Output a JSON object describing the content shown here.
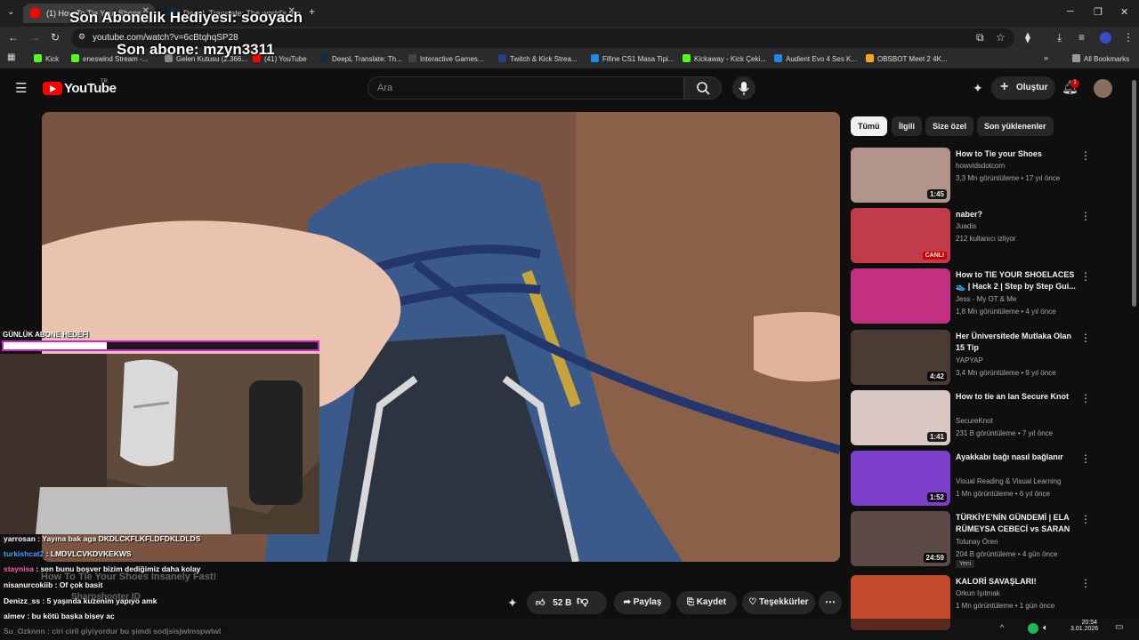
{
  "browser": {
    "tabs": [
      {
        "title": "(1) How To Tie Your Shoes",
        "active": true
      },
      {
        "title": "DeepL Translate: The world's most accurate translator",
        "active": false
      }
    ],
    "new_tab": "+",
    "url": "youtube.com/watch?v=6cBtqhqSP28",
    "bookmarks": [
      {
        "label": "Kick",
        "color": "#53fc18"
      },
      {
        "label": "eneswind Stream -...",
        "color": "#53fc18"
      },
      {
        "label": "Gelen Kutusu (2.366...",
        "color": "#888888"
      },
      {
        "label": "(41) YouTube",
        "color": "#ff0000"
      },
      {
        "label": "DeepL Translate: Th...",
        "color": "#0f2b46"
      },
      {
        "label": "Interactive Games...",
        "color": "#444444"
      },
      {
        "label": "Twitch & Kick Strea...",
        "color": "#2a3f8a"
      },
      {
        "label": "Fifine CS1 Masa Tipi...",
        "color": "#1e88e5"
      },
      {
        "label": "Kickaway - Kick Çeki...",
        "color": "#53fc18"
      },
      {
        "label": "Audient Evo 4 Ses K...",
        "color": "#1e88e5"
      },
      {
        "label": "OBSBOT Meet 2 4K...",
        "color": "#f5a623"
      }
    ],
    "all_bookmarks": "All Bookmarks"
  },
  "youtube": {
    "logo": "YouTube",
    "region": "TR",
    "search_placeholder": "Ara",
    "create_label": "Oluştur",
    "notification_count": "1",
    "chips": [
      "Tümü",
      "İlgili",
      "Size özel",
      "Son yüklenenler"
    ],
    "actions": {
      "likes": "52 B",
      "share": "Paylaş",
      "save": "Kaydet",
      "thanks": "Teşekkürler"
    },
    "recommendations": [
      {
        "title": "How to Tie your Shoes",
        "channel": "howvidsdotcom",
        "meta": "3,3 Mn görüntüleme • 17 yıl önce",
        "duration": "1:45",
        "color": "#b3948d"
      },
      {
        "title": "naber?",
        "channel": "Juadis",
        "meta": "212 kullanıcı izliyor",
        "badge": "CANLI",
        "color": "#c23b4a"
      },
      {
        "title": "How to TIE YOUR SHOELACES 👟 | Hack 2 | Step by Step Gui...",
        "channel": "Jess - My OT & Me",
        "meta": "1,8 Mn görüntüleme • 4 yıl önce",
        "color": "#c2307f"
      },
      {
        "title": "Her Üniversitede Mutlaka Olan 15 Tip",
        "channel": "YAPYAP",
        "meta": "3,4 Mn görüntüleme • 9 yıl önce",
        "duration": "4:42",
        "color": "#4a3c33"
      },
      {
        "title": "How to tie an Ian Secure Knot",
        "channel": "SecureKnot",
        "meta": "231 B görüntüleme • 7 yıl önce",
        "duration": "1:41",
        "color": "#d9c8c3"
      },
      {
        "title": "Ayakkabı bağı nasıl bağlanır",
        "channel": "Visual Reading & Visual Learning",
        "meta": "1 Mn görüntüleme • 6 yıl önce",
        "duration": "1:52",
        "color": "#7c3fc9"
      },
      {
        "title": "TÜRKİYE'NİN GÜNDEMİ | ELA RÜMEYSA CEBECİ vs SARAN",
        "channel": "Tolunay Ören",
        "meta": "204 B görüntüleme • 4 gün önce",
        "duration": "24:59",
        "new": "Yeni",
        "color": "#5b4a45"
      },
      {
        "title": "KALORİ SAVAŞLARI!",
        "channel": "Orkun Işıtmak",
        "meta": "1 Mn görüntüleme • 1 gün önce",
        "color": "#c24a2a"
      }
    ]
  },
  "stream_overlay": {
    "last_gift": "Son Abonelik Hediyesi: sooyach",
    "last_sub": "Son abone: mzyn3311",
    "goal_label": "GÜNLÜK ABONE HEDEFİ",
    "goal_progress": 0.33,
    "chat": [
      {
        "user": "yarrosan",
        "msg": " : Yayına bak aga DKDLCKFLKFLDFDKLDLDS",
        "color": "#ffffff"
      },
      {
        "user": "turkishcat2",
        "msg": " : LMDVLCVKDVKEKWS",
        "color": "#4aa3ff"
      },
      {
        "user": "staynisa",
        "msg": " : sen bunu boşver bizim dediğimiz daha kolay",
        "color": "#ff5fb0"
      },
      {
        "user": "nisanurcokiib",
        "msg": " : Of çok basit",
        "color": "#ffffff"
      },
      {
        "user": "Denizz_ss",
        "msg": " : 5 yaşında kuzenim yapıyo amk",
        "color": "#ffffff"
      },
      {
        "user": "aimev",
        "msg": " : bu kötü başka bişey aç",
        "color": "#ffffff"
      },
      {
        "user": "Su_Ozknnn",
        "msg": " : ciri cirli giyiyordur bu şimdi sodjsisjwlmspwlwl",
        "color": "#ffffff"
      }
    ],
    "ghost_title": "How To Tie Your Shoes Insanely Fast!",
    "ghost_channel": "Sharpshooter ID"
  },
  "taskbar": {
    "time": "20:54",
    "date": "3.01.2026"
  }
}
